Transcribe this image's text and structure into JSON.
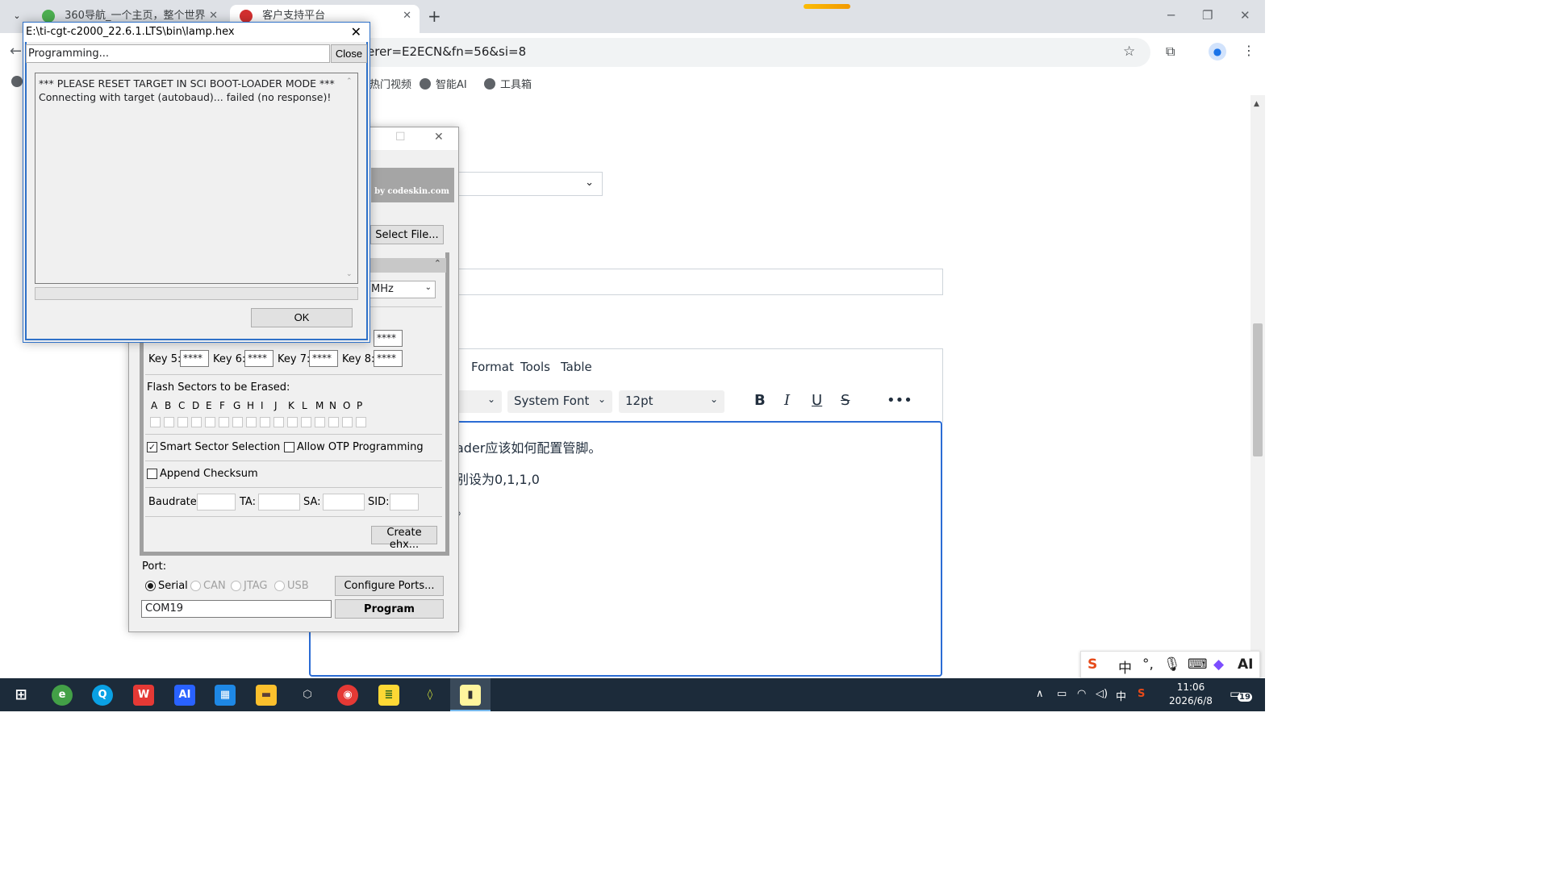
{
  "browser": {
    "tabs": [
      {
        "title": "360导航_一个主页，整个世界",
        "favicon_color": "#4caf50"
      },
      {
        "title": "客户支持平台",
        "favicon_color": "#d32f2f"
      }
    ],
    "url_fragment": "erer=E2ECN&fn=56&si=8",
    "bookmarks": [
      "热门视频",
      "智能AI",
      "工具箱"
    ]
  },
  "page": {
    "by_line": "by codeskin.com",
    "editor": {
      "menus": [
        "Format",
        "Tools",
        "Table"
      ],
      "font_family": "System Font",
      "font_size": "12pt",
      "format_icons": [
        "bold-icon",
        "italic-icon",
        "underline-icon",
        "strikethrough-icon",
        "more-icon"
      ],
      "lines": [
        "ader应该如何配置管脚。",
        "别设为0,1,1,0",
        "。"
      ]
    }
  },
  "tool": {
    "select_file_label": "Select File...",
    "clock_value": "MHz",
    "keys": [
      {
        "label": "Key 5:",
        "value": "****"
      },
      {
        "label": "Key 6:",
        "value": "****"
      },
      {
        "label": "Key 7:",
        "value": "****"
      },
      {
        "label": "Key 8:",
        "value": "****"
      }
    ],
    "key4_value": "****",
    "sectors_label": "Flash Sectors to be Erased:",
    "sector_letters": [
      "A",
      "B",
      "C",
      "D",
      "E",
      "F",
      "G",
      "H",
      "I",
      "J",
      "K",
      "L",
      "M",
      "N",
      "O",
      "P"
    ],
    "smart_sector_label": "Smart Sector Selection",
    "smart_sector_checked": true,
    "otp_label": "Allow OTP Programming",
    "otp_checked": false,
    "append_checksum_label": "Append Checksum",
    "append_checksum_checked": false,
    "baudrate_label": "Baudrate:",
    "ta_label": "TA:",
    "sa_label": "SA:",
    "sid_label": "SID:",
    "create_ehx_label": "Create ehx...",
    "port_label": "Port:",
    "port_options": [
      "Serial",
      "CAN",
      "JTAG",
      "USB"
    ],
    "port_selected": "Serial",
    "configure_ports_label": "Configure Ports...",
    "port_value": "COM19",
    "program_label": "Program"
  },
  "dialog": {
    "title": "E:\\ti-cgt-c2000_22.6.1.LTS\\bin\\lamp.hex",
    "status": "Programming...",
    "close_label": "Close",
    "log_lines": [
      "*** PLEASE RESET TARGET IN SCI BOOT-LOADER MODE ***",
      "Connecting with target (autobaud)...  failed (no response)!"
    ],
    "progress": 0,
    "ok_label": "OK"
  },
  "ime": {
    "lang": "中",
    "punct": "°,"
  },
  "taskbar": {
    "apps": [
      "start",
      "360-browser",
      "edge",
      "wps",
      "ai-app",
      "calculator",
      "file-explorer",
      "3d-viewer",
      "chrome",
      "notepad",
      "flash-tool",
      "uniflash"
    ],
    "tray_lang": "中",
    "time": "11:06",
    "date": "2026/6/8",
    "notification_count": "19"
  },
  "colors": {
    "accent": "#2b6cd4",
    "taskbar": "#1c2b3a",
    "dialog_border": "#2f71c8"
  }
}
